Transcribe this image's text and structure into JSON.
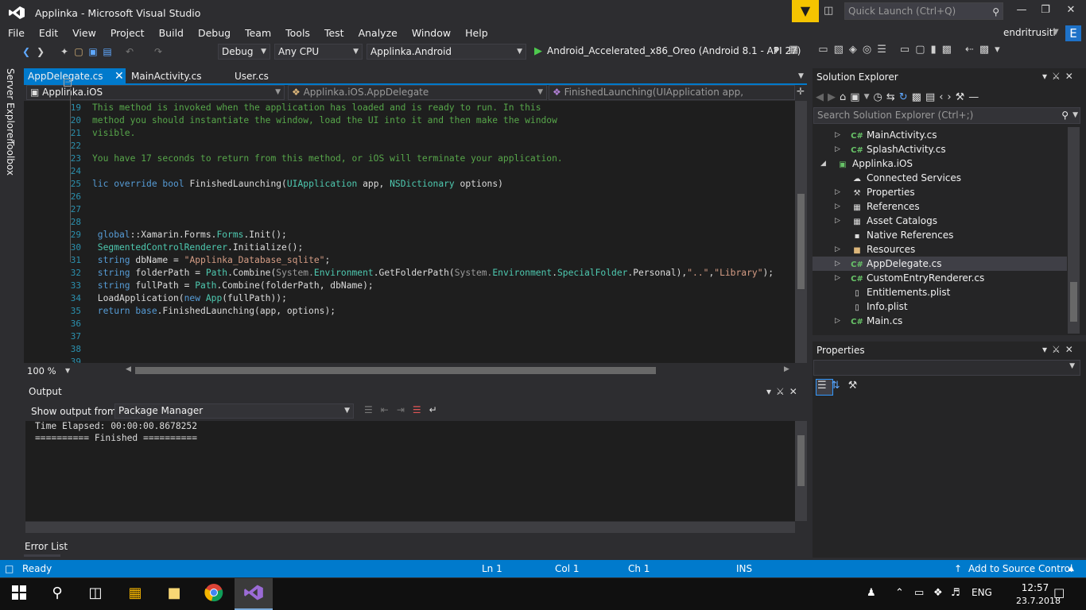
{
  "window": {
    "title": "Applinka - Microsoft Visual Studio",
    "quick_launch_placeholder": "Quick Launch (Ctrl+Q)",
    "user_name": "endritrusiti",
    "user_initial": "E"
  },
  "menu": [
    "File",
    "Edit",
    "View",
    "Project",
    "Build",
    "Debug",
    "Team",
    "Tools",
    "Test",
    "Analyze",
    "Window",
    "Help"
  ],
  "toolbar": {
    "configuration": "Debug",
    "platform": "Any CPU",
    "startup_project": "Applinka.Android",
    "run_target": "Android_Accelerated_x86_Oreo (Android 8.1 - API 27)"
  },
  "side_tabs": [
    "Server Explorer",
    "Toolbox"
  ],
  "doc_tabs": [
    "AppDelegate.cs",
    "MainActivity.cs",
    "User.cs"
  ],
  "nav": {
    "project": "Applinka.iOS",
    "type": "Applinka.iOS.AppDelegate",
    "member": "FinishedLaunching(UIApplication app, NSDictionary op"
  },
  "editor": {
    "line_numbers": [
      "19",
      "20",
      "21",
      "22",
      "23",
      "24",
      "25",
      "26",
      "27",
      "28",
      "29",
      "30",
      "31",
      "32",
      "33",
      "34",
      "35",
      "36",
      "37",
      "38",
      "39"
    ],
    "zoom": "100 %"
  },
  "output": {
    "title": "Output",
    "show_output_from_label": "Show output from:",
    "source": "Package Manager",
    "lines": [
      "Time Elapsed: 00:00:00.8678252",
      "========== Finished =========="
    ]
  },
  "error_list_tab": "Error List",
  "solution_explorer": {
    "title": "Solution Explorer",
    "search_placeholder": "Search Solution Explorer (Ctrl+;)",
    "items": [
      {
        "label": "MainActivity.cs",
        "icon": "csharp-file-icon"
      },
      {
        "label": "SplashActivity.cs",
        "icon": "csharp-file-icon"
      },
      {
        "label": "Applinka.iOS",
        "icon": "project-icon"
      },
      {
        "label": "Connected Services",
        "icon": "connected-services-icon"
      },
      {
        "label": "Properties",
        "icon": "wrench-icon"
      },
      {
        "label": "References",
        "icon": "references-icon"
      },
      {
        "label": "Asset Catalogs",
        "icon": "asset-catalog-icon"
      },
      {
        "label": "Native References",
        "icon": "native-references-icon"
      },
      {
        "label": "Resources",
        "icon": "folder-icon"
      },
      {
        "label": "AppDelegate.cs",
        "icon": "csharp-file-icon"
      },
      {
        "label": "CustomEntryRenderer.cs",
        "icon": "csharp-file-icon"
      },
      {
        "label": "Entitlements.plist",
        "icon": "plist-file-icon"
      },
      {
        "label": "Info.plist",
        "icon": "plist-file-icon"
      },
      {
        "label": "Main.cs",
        "icon": "csharp-file-icon"
      }
    ]
  },
  "properties": {
    "title": "Properties"
  },
  "status": {
    "state": "Ready",
    "ln": "Ln 1",
    "col": "Col 1",
    "ch": "Ch 1",
    "mode": "INS",
    "source_control": "Add to Source Control"
  },
  "taskbar": {
    "language": "ENG",
    "time": "12:57",
    "date": "23.7.2018"
  },
  "colors": {
    "accent": "#007acc",
    "editor_bg": "#1e1e1e",
    "chrome_bg": "#2d2d30",
    "comment": "#57a64a",
    "keyword": "#569cd6",
    "type": "#4ec9b0",
    "string": "#d69d85",
    "filter_button": "#f5c400"
  }
}
